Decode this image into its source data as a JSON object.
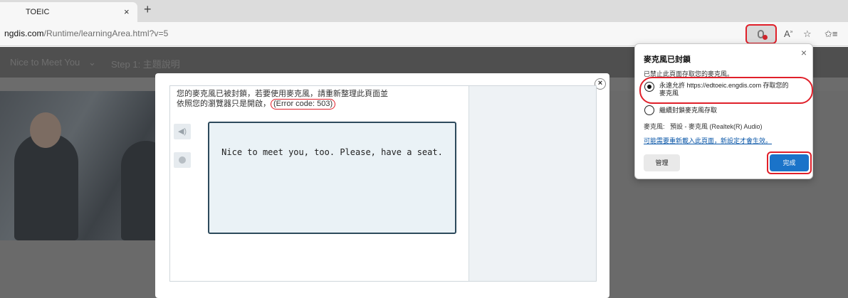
{
  "browser": {
    "tab": {
      "title": "TOEIC",
      "close": "×"
    },
    "new_tab": "+",
    "url_host": "ngdis.com",
    "url_path": "/Runtime/learningArea.html?v=5"
  },
  "page": {
    "nav": [
      "Nice to Meet You",
      "Step 1: 主題說明"
    ]
  },
  "modal": {
    "close": "×",
    "message_line1": "您的麥克風已被封鎖，若要使用麥克風，請重新整理此頁面並",
    "message_line2": "依照您的瀏覽器只是開啟，",
    "error_code": "(Error code: 503)",
    "sentence": "Nice to meet you, too. Please, have a seat."
  },
  "popup": {
    "title": "麥克風已封鎖",
    "subtitle": "已禁止此頁面存取您的麥克風。",
    "option_allow_line1": "永遠允許 https://edtoeic.engdis.com 存取您的",
    "option_allow_line2": "麥克風",
    "option_block": "繼續封鎖麥克風存取",
    "mic_label": "麥克風:",
    "mic_device": "預設 - 麥克風 (Realtek(R) Audio)",
    "reload_note": "可能需要重新載入此頁面，新設定才會生效。",
    "manage": "管理",
    "done": "完成",
    "close": "×"
  },
  "colors": {
    "highlight": "#e0202a",
    "primary_button": "#1a73c9",
    "sentence_border": "#2d4a5c"
  }
}
